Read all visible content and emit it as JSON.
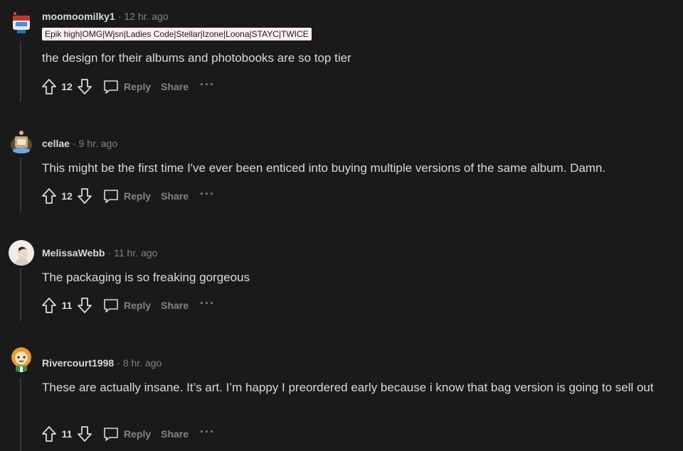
{
  "comments": [
    {
      "username": "moomoomilky1",
      "separator": "·",
      "time": "12 hr. ago",
      "flair": "Epik high|OMG|Wjsn|Ladies Code|Stellar|Izone|Loona|STAYC|TWICE",
      "body": "the design for their albums and photobooks are so top tier",
      "score": "12",
      "reply_label": "Reply",
      "share_label": "Share",
      "more_label": "···"
    },
    {
      "username": "cellae",
      "separator": "·",
      "time": "9 hr. ago",
      "body": "This might be the first time I've ever been enticed into buying multiple versions of the same album. Damn.",
      "score": "12",
      "reply_label": "Reply",
      "share_label": "Share",
      "more_label": "···"
    },
    {
      "username": "MelissaWebb",
      "separator": "·",
      "time": "11 hr. ago",
      "body": "The packaging is so freaking gorgeous",
      "score": "11",
      "reply_label": "Reply",
      "share_label": "Share",
      "more_label": "···"
    },
    {
      "username": "Rivercourt1998",
      "separator": "·",
      "time": "8 hr. ago",
      "body": "These are actually insane. It’s art. I’m happy I preordered early because i know that bag version is going to sell out",
      "score": "11",
      "reply_label": "Reply",
      "share_label": "Share",
      "more_label": "···"
    }
  ],
  "icons": {
    "upvote": "arrow-up-outline-icon",
    "downvote": "arrow-down-outline-icon",
    "reply": "speech-bubble-icon",
    "more": "ellipsis-icon"
  },
  "colors": {
    "background": "#1a1a1b",
    "text": "#d7dadc",
    "muted": "#818384",
    "flair_bg": "#fdeef1",
    "thread_line": "#343536"
  }
}
